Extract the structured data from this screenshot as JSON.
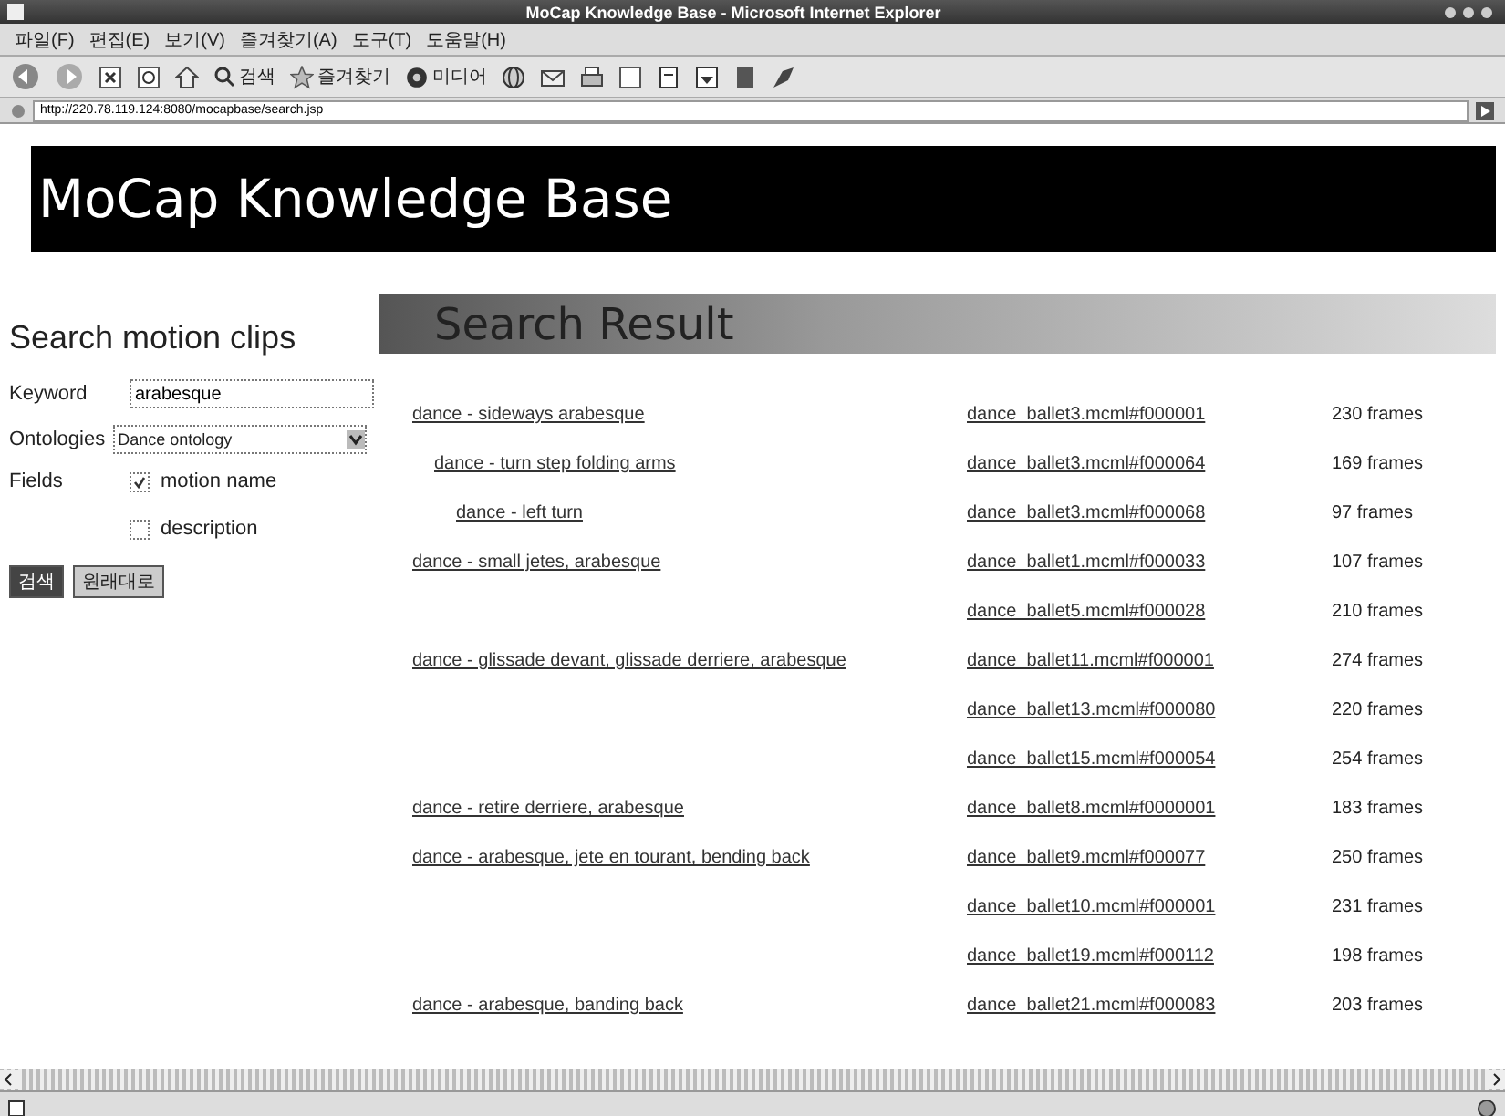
{
  "window": {
    "title": "MoCap Knowledge Base - Microsoft Internet Explorer"
  },
  "menu": [
    "파일(F)",
    "편집(E)",
    "보기(V)",
    "즐겨찾기(A)",
    "도구(T)",
    "도움말(H)"
  ],
  "toolbar": [
    {
      "kind": "search",
      "label": "검색"
    },
    {
      "kind": "favorites",
      "label": "즐겨찾기"
    },
    {
      "kind": "media",
      "label": "미디어"
    }
  ],
  "address": {
    "value": "http://220.78.119.124:8080/mocapbase/search.jsp"
  },
  "banner": {
    "title": "MoCap Knowledge Base"
  },
  "search_panel": {
    "heading": "Search motion clips",
    "keyword": {
      "label": "Keyword",
      "value": "arabesque"
    },
    "ontologies": {
      "label": "Ontologies",
      "value": "Dance ontology"
    },
    "fields": {
      "label": "Fields",
      "options": [
        {
          "label": "motion name",
          "checked": true
        },
        {
          "label": "description",
          "checked": false
        }
      ]
    },
    "buttons": [
      {
        "kind": "primary",
        "label": "검색"
      },
      {
        "kind": "secondary",
        "label": "원래대로"
      }
    ]
  },
  "results": {
    "heading": "Search Result",
    "items": [
      {
        "motion": "dance - sideways arabesque",
        "clips": [
          {
            "file": "dance_ballet3.mcml#f000001",
            "frames": "230 frames"
          }
        ],
        "children": [
          {
            "motion": "dance - turn step folding arms",
            "clips": [
              {
                "file": "dance_ballet3.mcml#f000064",
                "frames": "169 frames"
              }
            ],
            "children": [
              {
                "motion": "dance - left turn",
                "clips": [
                  {
                    "file": "dance_ballet3.mcml#f000068",
                    "frames": "97 frames"
                  }
                ]
              }
            ]
          }
        ]
      },
      {
        "motion": "dance - small jetes, arabesque",
        "clips": [
          {
            "file": "dance_ballet1.mcml#f000033",
            "frames": "107 frames"
          },
          {
            "file": "dance_ballet5.mcml#f000028",
            "frames": "210 frames"
          }
        ]
      },
      {
        "motion": "dance - glissade devant, glissade derriere, arabesque",
        "clips": [
          {
            "file": "dance_ballet11.mcml#f000001",
            "frames": "274 frames"
          },
          {
            "file": "dance_ballet13.mcml#f000080",
            "frames": "220 frames"
          },
          {
            "file": "dance_ballet15.mcml#f000054",
            "frames": "254 frames"
          }
        ]
      },
      {
        "motion": "dance - retire derriere, arabesque",
        "clips": [
          {
            "file": "dance_ballet8.mcml#f0000001",
            "frames": "183 frames"
          }
        ]
      },
      {
        "motion": "dance - arabesque, jete en tourant, bending back",
        "clips": [
          {
            "file": "dance_ballet9.mcml#f000077",
            "frames": "250 frames"
          },
          {
            "file": "dance_ballet10.mcml#f000001",
            "frames": "231 frames"
          },
          {
            "file": "dance_ballet19.mcml#f000112",
            "frames": "198 frames"
          }
        ]
      },
      {
        "motion": "dance - arabesque, banding back",
        "clips": [
          {
            "file": "dance_ballet21.mcml#f000083",
            "frames": "203 frames"
          }
        ]
      }
    ]
  }
}
